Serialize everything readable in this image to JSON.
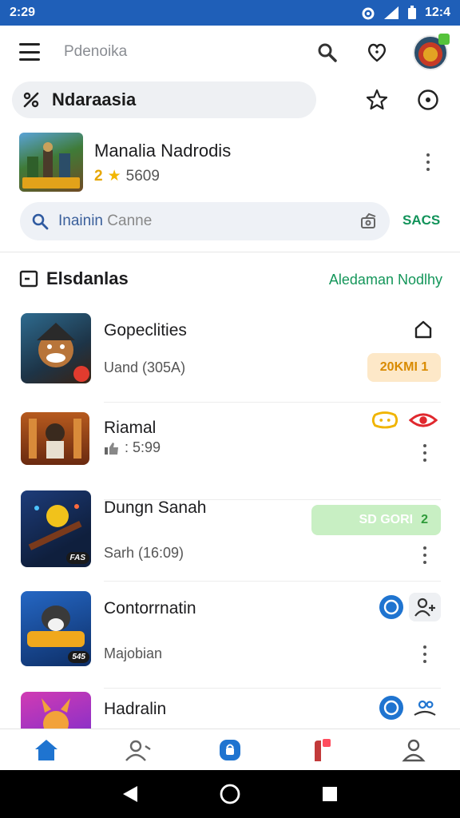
{
  "status_bar": {
    "time": "2:29",
    "clock_right": "12:4"
  },
  "app_bar": {
    "search_title": "Pdenoika"
  },
  "chip": {
    "label": "Ndaraasia"
  },
  "featured": {
    "title": "Manalia Nadrodis",
    "rating": "2",
    "rating_count": "5609"
  },
  "search": {
    "placeholder_blue": "Inainin",
    "placeholder_grey": " Canne",
    "action": "SACS"
  },
  "section": {
    "title": "Elsdanlas",
    "link": "Aledaman Nodlhy"
  },
  "games": [
    {
      "title": "Gopeclities",
      "subtitle": "Uand (305A)",
      "pill": "20KMI 1"
    },
    {
      "title": "Riamal",
      "subtitle": ": 5:99"
    },
    {
      "title": "Dungn Sanah",
      "subtitle": "Sarh (16:09)",
      "pill_text": "SD GORI",
      "pill_num": "2",
      "badge": "FAS"
    },
    {
      "title": "Contorrnatin",
      "subtitle": "Majobian",
      "badge": "545"
    },
    {
      "title": "Hadralin"
    }
  ],
  "colors": {
    "accent_blue": "#1f74d0",
    "link_green": "#14965a",
    "status_bar": "#1f5fb8"
  }
}
